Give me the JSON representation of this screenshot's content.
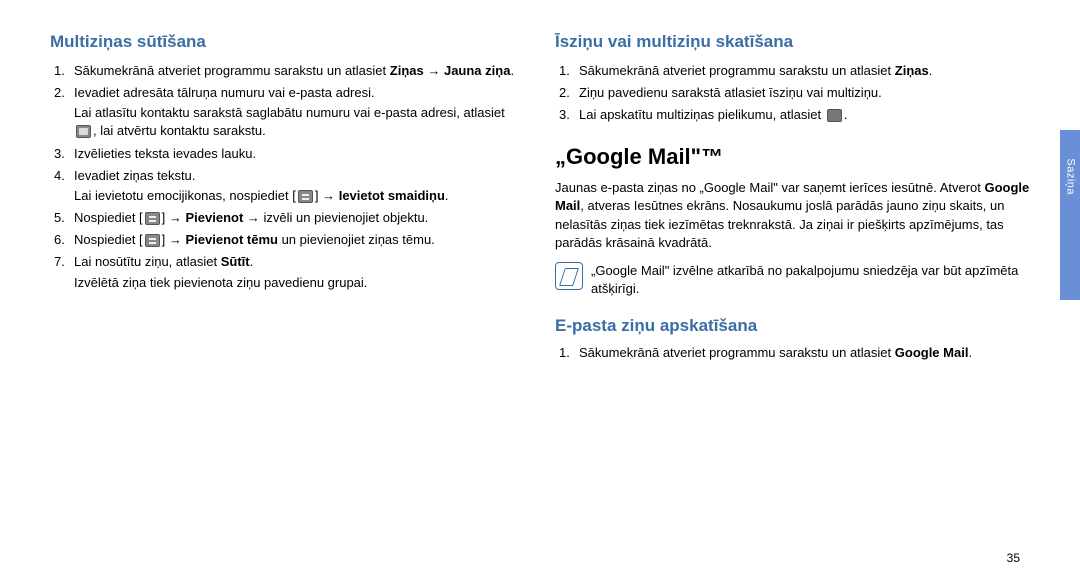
{
  "side_label": "Saziņa",
  "page_number": "35",
  "left": {
    "h2": "Multiziņas sūtīšana",
    "items": [
      {
        "num": "1.",
        "text_a": "Sākumekrānā atveriet programmu sarakstu un atlasiet ",
        "bold_a": "Ziņas",
        "arrow": " → ",
        "bold_b": "Jauna ziņa",
        "tail": "."
      },
      {
        "num": "2.",
        "text_a": "Ievadiet adresāta tālruņa numuru vai e-pasta adresi.",
        "sub": "Lai atlasītu kontaktu sarakstā saglabātu numuru vai e-pasta adresi, atlasiet ",
        "sub_after_icon": ", lai atvērtu kontaktu sarakstu."
      },
      {
        "num": "3.",
        "text_a": "Izvēlieties teksta ievades lauku."
      },
      {
        "num": "4.",
        "text_a": "Ievadiet ziņas tekstu.",
        "sub": "Lai ievietotu emocijikonas, nospiediet [",
        "sub_after_icon": "] → ",
        "sub_bold": "Ievietot smaidiņu",
        "sub_tail": "."
      },
      {
        "num": "5.",
        "text_a": "Nospiediet [",
        "after_icon": "] → ",
        "bold_a": "Pievienot",
        "mid": " → izvēli un pievienojiet objektu."
      },
      {
        "num": "6.",
        "text_a": "Nospiediet [",
        "after_icon": "] → ",
        "bold_a": "Pievienot tēmu",
        "mid": " un pievienojiet ziņas tēmu."
      },
      {
        "num": "7.",
        "text_a": "Lai nosūtītu ziņu, atlasiet ",
        "bold_a": "Sūtīt",
        "tail": ".",
        "sub": "Izvēlētā ziņa tiek pievienota ziņu pavedienu grupai."
      }
    ]
  },
  "right": {
    "h2": "Īsziņu vai multiziņu skatīšana",
    "items": [
      {
        "num": "1.",
        "text_a": "Sākumekrānā atveriet programmu sarakstu un atlasiet ",
        "bold_a": "Ziņas",
        "tail": "."
      },
      {
        "num": "2.",
        "text_a": "Ziņu pavedienu sarakstā atlasiet īsziņu vai multiziņu."
      },
      {
        "num": "3.",
        "text_a": "Lai apskatītu multiziņas pielikumu, atlasiet ",
        "has_icon": true,
        "tail": "."
      }
    ],
    "h1": "„Google Mail\"™",
    "para": "Jaunas e-pasta ziņas no „Google Mail\" var saņemt ierīces iesūtnē. Atverot ",
    "para_bold": "Google Mail",
    "para_after": ", atveras Iesūtnes ekrāns. Nosaukumu joslā parādās jauno ziņu skaits, un nelasītās ziņas tiek iezīmētas treknrakstā. Ja ziņai ir piešķirts apzīmējums, tas parādās krāsainā kvadrātā.",
    "note": "„Google Mail\" izvēlne atkarībā no pakalpojumu sniedzēja var būt apzīmēta atšķirīgi.",
    "h3": "E-pasta ziņu apskatīšana",
    "items2": [
      {
        "num": "1.",
        "text_a": "Sākumekrānā atveriet programmu sarakstu un atlasiet ",
        "bold_a": "Google Mail",
        "tail": "."
      }
    ]
  }
}
